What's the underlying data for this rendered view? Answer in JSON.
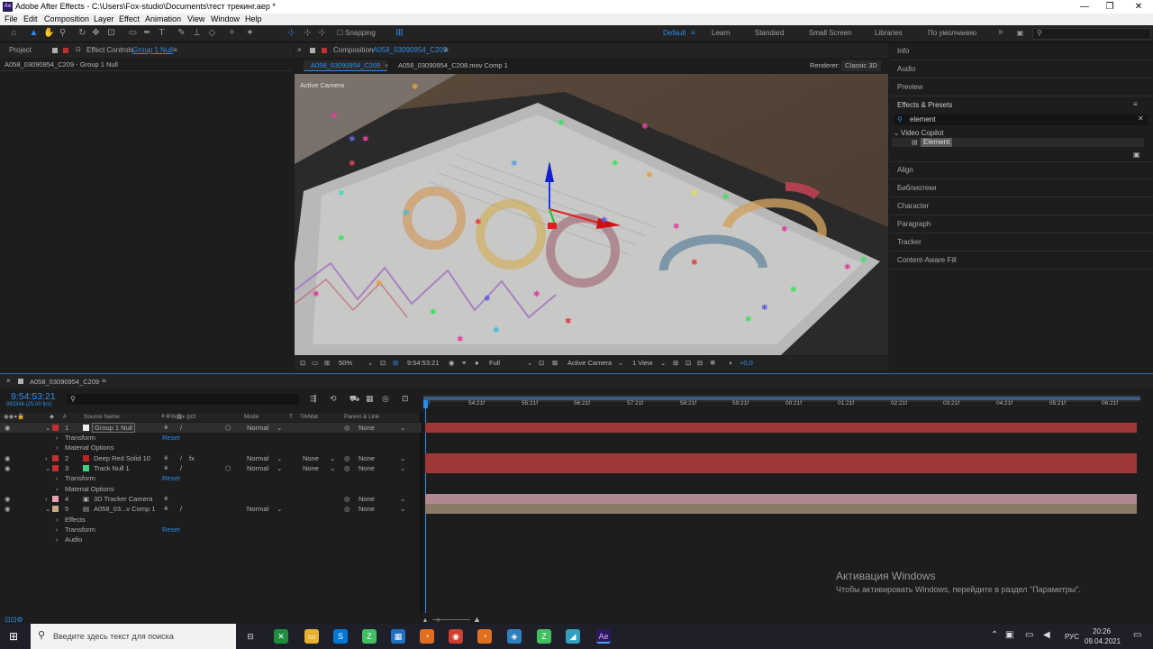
{
  "window": {
    "title": "Adobe After Effects - C:\\Users\\Fox-studio\\Documents\\тест трекинг.aep *",
    "minimize": "—",
    "maximize": "❐",
    "close": "✕"
  },
  "menu": [
    "File",
    "Edit",
    "Composition",
    "Layer",
    "Effect",
    "Animation",
    "View",
    "Window",
    "Help"
  ],
  "toolbar": {
    "snapping": "Snapping",
    "workspaces": [
      "Default",
      "Learn",
      "Standard",
      "Small Screen",
      "Libraries",
      "По умолчанию"
    ],
    "more": "»"
  },
  "left_panel": {
    "tab_project": "Project",
    "tab_effect_controls": "Effect Controls",
    "tab_effect_controls_target": "Group 1 Null",
    "subtitle": "A058_03090954_C209 - Group 1 Null"
  },
  "comp_panel": {
    "tab_label": "Composition",
    "tab_comp_name": "A058_03090954_C209",
    "breadcrumb_active": "A058_03090954_C209",
    "breadcrumb_next": "A058_03090954_C208.mov Comp 1",
    "renderer_label": "Renderer:",
    "renderer_value": "Classic 3D",
    "active_camera_label": "Active Camera",
    "bottom_zoom": "50%",
    "bottom_timecode": "9:54:53:21",
    "bottom_resolution": "Full",
    "bottom_camera": "Active Camera",
    "bottom_view": "1 View",
    "bottom_exposure": "+0,0"
  },
  "right_panel": {
    "items": [
      "Info",
      "Audio",
      "Preview",
      "Effects & Presets"
    ],
    "search_value": "element",
    "group": "Video Copilot",
    "result": "Element",
    "items_below": [
      "Align",
      "Библиотеки",
      "Character",
      "Paragraph",
      "Tracker",
      "Content-Aware Fill"
    ]
  },
  "timeline": {
    "tab_name": "A058_03090954_C209",
    "timecode": "9:54:53:21",
    "timecode_sub": "892346 (25.00 fps)",
    "col_source": "Source Name",
    "col_mode": "Mode",
    "col_t": "T",
    "col_trkmat": "TrkMat",
    "col_parent": "Parent & Link",
    "ruler": [
      "54:21f",
      "55:21f",
      "56:21f",
      "57:21f",
      "58:21f",
      "59:21f",
      "00:21f",
      "01:21f",
      "02:21f",
      "03:21f",
      "04:21f",
      "05:21f",
      "06:21f"
    ],
    "ruler_start": "3f",
    "layers": [
      {
        "num": "1",
        "name": "Group 1 Null",
        "mode": "Normal",
        "trkmat": "",
        "parent": "None",
        "color": "#d0d0d0"
      },
      {
        "num": "2",
        "name": "Deep Red Solid 10",
        "mode": "Normal",
        "trkmat": "None",
        "parent": "None",
        "color": "#c02020"
      },
      {
        "num": "3",
        "name": "Track Null 1",
        "mode": "Normal",
        "trkmat": "None",
        "parent": "None",
        "color": "#40d080"
      },
      {
        "num": "4",
        "name": "3D Tracker Camera",
        "mode": "",
        "trkmat": "",
        "parent": "None",
        "color": "#e8a0b0"
      },
      {
        "num": "5",
        "name": "A058_03...v Comp 1",
        "mode": "Normal",
        "trkmat": "",
        "parent": "None",
        "color": "#c8a888"
      }
    ],
    "sub_transform": "Transform",
    "sub_material": "Material Options",
    "sub_effects": "Effects",
    "sub_audio": "Audio",
    "reset": "Reset"
  },
  "watermark": {
    "title": "Активация Windows",
    "body": "Чтобы активировать Windows, перейдите в раздел \"Параметры\"."
  },
  "taskbar": {
    "search_placeholder": "Введите здесь текст для поиска",
    "lang": "РУС",
    "time": "20:26",
    "date": "09.04.2021"
  },
  "colors": {
    "accent_blue": "#2d8ceb",
    "bar_red": "#a03838",
    "bar_pink": "#b08890",
    "bar_tan": "#8a7a68"
  }
}
